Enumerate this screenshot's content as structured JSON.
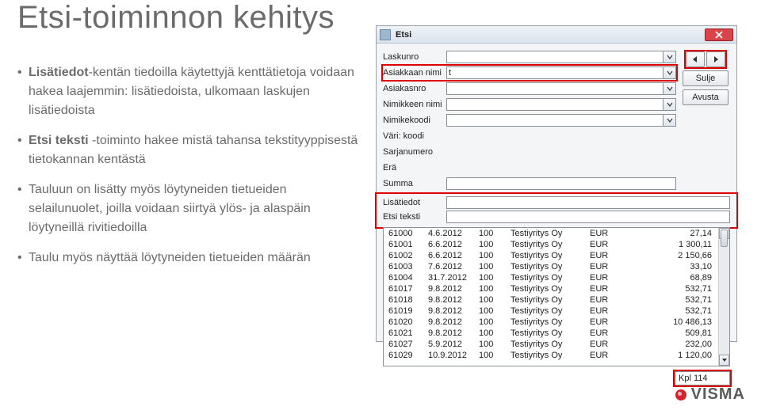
{
  "title": "Etsi-toiminnon kehitys",
  "bullets": [
    {
      "prefix_bold": "Lisätiedot",
      "rest": "-kentän tiedoilla käytettyjä kenttätietoja voidaan hakea laajemmin: lisätiedoista, ulkomaan laskujen lisätiedoista"
    },
    {
      "prefix_bold": "Etsi teksti",
      "rest": " -toiminto hakee mistä tahansa tekstityyppisestä tietokannan kentästä"
    },
    {
      "prefix_bold": "",
      "rest": "Tauluun on lisätty myös löytyneiden tietueiden selailunuolet, joilla voidaan siirtyä ylös- ja alaspäin löytyneillä rivitiedoilla"
    },
    {
      "prefix_bold": "",
      "rest": "Taulu myös näyttää löytyneiden tietueiden määrän"
    }
  ],
  "window": {
    "title": "Etsi",
    "labels": {
      "laskunro": "Laskunro",
      "asiakkaan_nimi": "Asiakkaan nimi",
      "asiakasnro": "Asiakasnro",
      "nimikkeen_nimi": "Nimikkeen nimi",
      "nimikekoodi": "Nimikekoodi",
      "vari_koodi": "Väri: koodi",
      "sarjanumero": "Sarjanumero",
      "era": "Erä",
      "summa": "Summa",
      "lisatiedot": "Lisätiedot",
      "etsi_teksti": "Etsi teksti"
    },
    "values": {
      "asiakkaan_nimi": "t"
    },
    "buttons": {
      "sulje": "Sulje",
      "avusta": "Avusta"
    },
    "status": {
      "kpl_label": "Kpl",
      "kpl_value": "114"
    },
    "table": {
      "rows": [
        [
          "61000",
          "4.6.2012",
          "100",
          "Testiyritys Oy",
          "EUR",
          "27,14"
        ],
        [
          "61001",
          "6.6.2012",
          "100",
          "Testiyritys Oy",
          "EUR",
          "1 300,11"
        ],
        [
          "61002",
          "6.6.2012",
          "100",
          "Testiyritys Oy",
          "EUR",
          "2 150,66"
        ],
        [
          "61003",
          "7.6.2012",
          "100",
          "Testiyritys Oy",
          "EUR",
          "33,10"
        ],
        [
          "61004",
          "31.7.2012",
          "100",
          "Testiyritys Oy",
          "EUR",
          "68,89"
        ],
        [
          "61017",
          "9.8.2012",
          "100",
          "Testiyritys Oy",
          "EUR",
          "532,71"
        ],
        [
          "61018",
          "9.8.2012",
          "100",
          "Testiyritys Oy",
          "EUR",
          "532,71"
        ],
        [
          "61019",
          "9.8.2012",
          "100",
          "Testiyritys Oy",
          "EUR",
          "532,71"
        ],
        [
          "61020",
          "9.8.2012",
          "100",
          "Testiyritys Oy",
          "EUR",
          "10 486,13"
        ],
        [
          "61021",
          "9.8.2012",
          "100",
          "Testiyritys Oy",
          "EUR",
          "509,81"
        ],
        [
          "61027",
          "5.9.2012",
          "100",
          "Testiyritys Oy",
          "EUR",
          "232,00"
        ],
        [
          "61029",
          "10.9.2012",
          "100",
          "Testiyritys Oy",
          "EUR",
          "1 120,00"
        ]
      ]
    }
  },
  "logo": {
    "text": "VISMA"
  }
}
